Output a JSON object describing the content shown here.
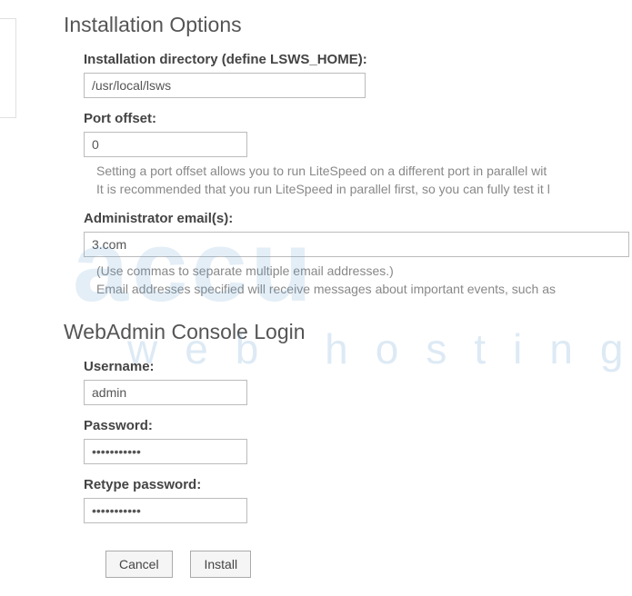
{
  "sections": {
    "install_options": {
      "title": "Installation Options",
      "install_dir_label": "Installation directory (define LSWS_HOME):",
      "install_dir_value": "/usr/local/lsws",
      "port_offset_label": "Port offset:",
      "port_offset_value": "0",
      "port_offset_help1": "Setting a port offset allows you to run LiteSpeed on a different port in parallel wit",
      "port_offset_help2": "It is recommended that you run LiteSpeed in parallel first, so you can fully test it l",
      "admin_email_label": "Administrator email(s):",
      "admin_email_value": "3.com",
      "admin_email_help1": "(Use commas to separate multiple email addresses.)",
      "admin_email_help2": "Email addresses specified will receive messages about important events, such as"
    },
    "webadmin": {
      "title": "WebAdmin Console Login",
      "username_label": "Username:",
      "username_value": "admin",
      "password_label": "Password:",
      "password_value": "•••••••••••",
      "retype_label": "Retype password:",
      "retype_value": "•••••••••••"
    }
  },
  "buttons": {
    "cancel": "Cancel",
    "install": "Install"
  },
  "watermark": {
    "line1": "accu",
    "line2": "web hosting"
  }
}
